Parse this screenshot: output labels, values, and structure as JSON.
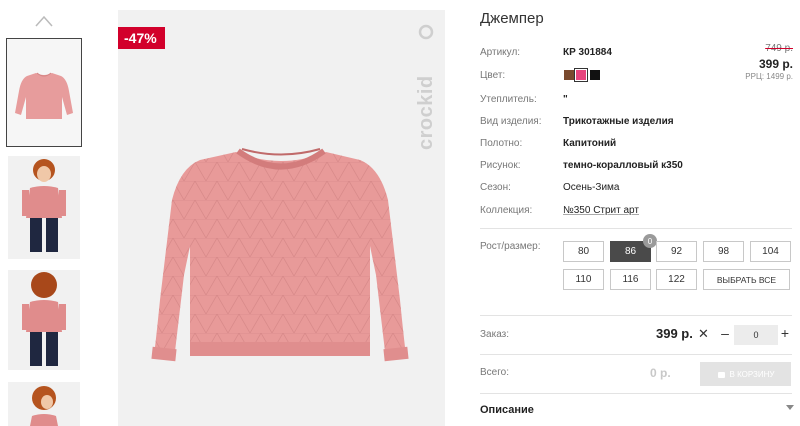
{
  "gallery": {
    "discount_badge": "-47%",
    "brand_logo_text": "crockid"
  },
  "product": {
    "title": "Джемпер",
    "old_price": "749 р.",
    "price": "399 р.",
    "rrp": "РРЦ: 1499 р.",
    "attributes": [
      {
        "label": "Артикул:",
        "value": "КР 301884"
      },
      {
        "label": "Цвет:",
        "value": ""
      },
      {
        "label": "Утеплитель:",
        "value": "\""
      },
      {
        "label": "Вид изделия:",
        "value": "Трикотажные изделия"
      },
      {
        "label": "Полотно:",
        "value": "Капитоний"
      },
      {
        "label": "Рисунок:",
        "value": "темно-коралловый к350"
      },
      {
        "label": "Сезон:",
        "value": "Осень-Зима"
      },
      {
        "label": "Коллекция:",
        "value": "№350 Стрит арт"
      }
    ],
    "colors": [
      "#7a4a2e",
      "#e8457e",
      "#111111"
    ],
    "selected_color_index": 1
  },
  "sizes": {
    "label": "Рост/размер:",
    "options": [
      "80",
      "86",
      "92",
      "98",
      "104",
      "110",
      "116",
      "122"
    ],
    "selected": "86",
    "selected_count": "0",
    "choose_all_label": "ВЫБРАТЬ ВСЕ"
  },
  "order": {
    "label": "Заказ:",
    "price": "399 р.",
    "times": "✕",
    "minus": "–",
    "quantity": "0",
    "plus": "+"
  },
  "total": {
    "label": "Всего:",
    "value": "0 р.",
    "cart_button_label": "В КОРЗИНУ"
  },
  "description": {
    "label": "Описание"
  }
}
